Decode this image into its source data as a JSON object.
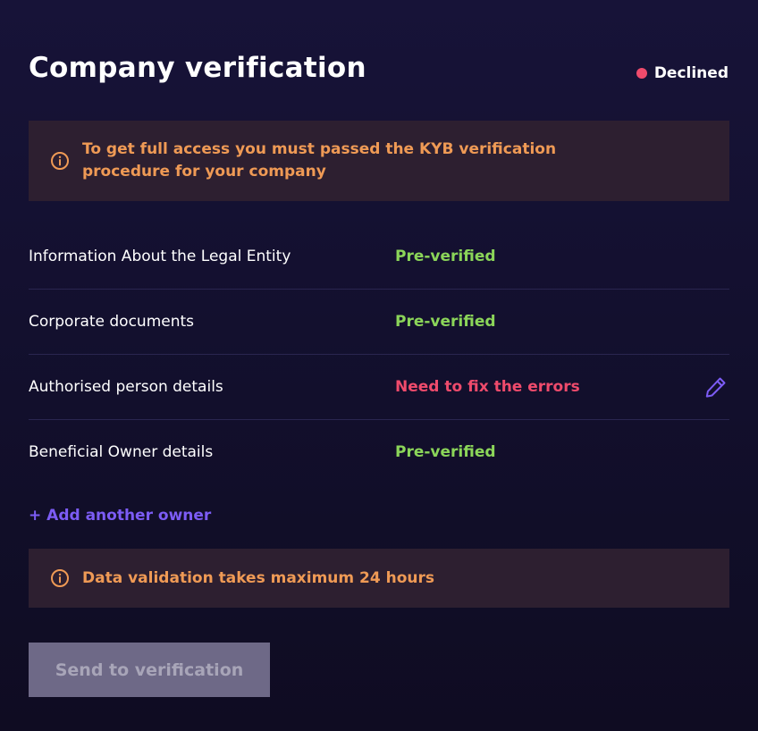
{
  "header": {
    "title": "Company verification",
    "status_label": "Declined"
  },
  "alerts": {
    "kyb_message": "To get full access you must passed the KYB verification procedure for your company",
    "validation_message": "Data validation takes maximum 24 hours"
  },
  "sections": [
    {
      "label": "Information About the Legal Entity",
      "status": "Pre-verified"
    },
    {
      "label": "Corporate documents",
      "status": "Pre-verified"
    },
    {
      "label": "Authorised person details",
      "status": "Need to fix the errors"
    },
    {
      "label": "Beneficial Owner details",
      "status": "Pre-verified"
    }
  ],
  "add_owner_label": "+ Add another owner",
  "send_button_label": "Send to verification",
  "colors": {
    "background": "#171338",
    "accent": "#7c5cf5",
    "success": "#8bd559",
    "error": "#ef4b6c",
    "warning_text": "#ef9a55",
    "warning_bg": "#2d1f30",
    "disabled_button": "#6e6987"
  },
  "icons": {
    "alert": "info-circle-icon",
    "edit": "pencil-icon",
    "status": "status-dot"
  }
}
